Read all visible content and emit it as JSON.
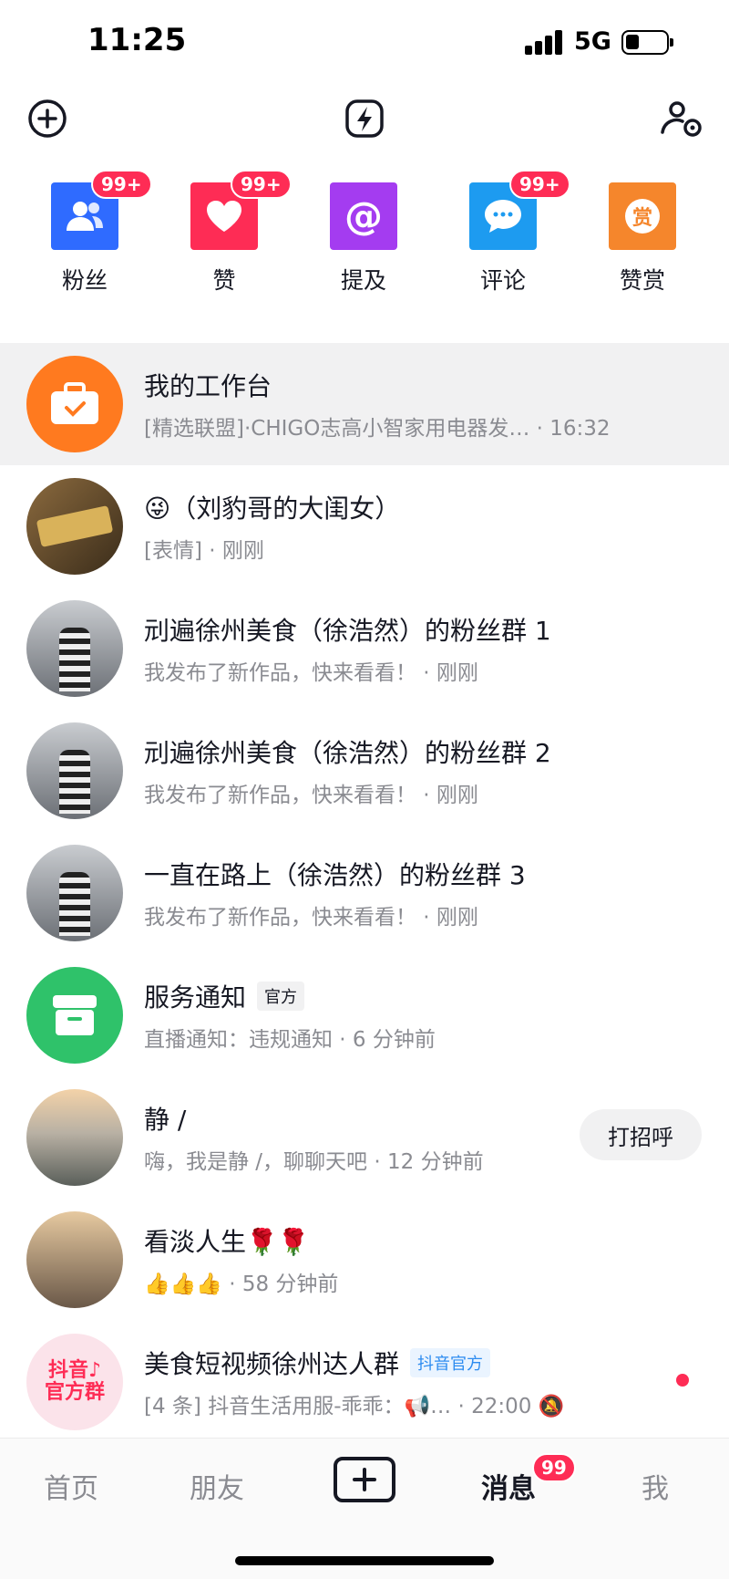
{
  "status": {
    "time": "11:25",
    "network": "5G"
  },
  "top_bar": {
    "left_icon": "add-circle-icon",
    "center_icon": "lightning-icon",
    "right_icon": "contacts-settings-icon"
  },
  "quick_actions": [
    {
      "label": "粉丝",
      "badge": "99+",
      "icon": "users-icon",
      "color": "#2f6bff"
    },
    {
      "label": "赞",
      "badge": "99+",
      "icon": "heart-icon",
      "color": "#fe2c55"
    },
    {
      "label": "提及",
      "badge": "",
      "icon": "at-icon",
      "color": "#a43cf0"
    },
    {
      "label": "评论",
      "badge": "99+",
      "icon": "comment-icon",
      "color": "#1d9bf0"
    },
    {
      "label": "赞赏",
      "badge": "",
      "icon": "reward-icon",
      "color": "#f5862c",
      "glyph": "赏"
    }
  ],
  "messages": [
    {
      "title": "我的工作台",
      "tag": "",
      "subtitle": "[精选联盟]·CHIGO志高小智家用电器发…  · 16:32"
    },
    {
      "title": "😜（刘豹哥的大闺女）",
      "tag": "",
      "subtitle": "[表情] · 刚刚"
    },
    {
      "title": "刓遍徐州美食（徐浩然）的粉丝群 1",
      "tag": "",
      "subtitle": "我发布了新作品，快来看看！ · 刚刚"
    },
    {
      "title": "刓遍徐州美食（徐浩然）的粉丝群 2",
      "tag": "",
      "subtitle": "我发布了新作品，快来看看！ · 刚刚"
    },
    {
      "title": "一直在路上（徐浩然）的粉丝群 3",
      "tag": "",
      "subtitle": "我发布了新作品，快来看看！ · 刚刚"
    },
    {
      "title": "服务通知",
      "tag": "官方",
      "subtitle": "直播通知：违规通知 · 6 分钟前"
    },
    {
      "title": "静 /",
      "tag": "",
      "subtitle": "嗨，我是静 /，聊聊天吧 · 12 分钟前",
      "action": "打招呼"
    },
    {
      "title": "看淡人生🌹🌹",
      "tag": "",
      "subtitle": "👍👍👍 · 58 分钟前"
    },
    {
      "title": "美食短视频徐州达人群",
      "tag": "抖音官方",
      "subtitle": "[4 条] 抖音生活用服-乖乖：📢…   · 22:00 🔕",
      "avatar_text": "抖音♪官方群"
    }
  ],
  "tabs": {
    "home": "首页",
    "friends": "朋友",
    "messages": "消息",
    "messages_badge": "99",
    "me": "我"
  }
}
